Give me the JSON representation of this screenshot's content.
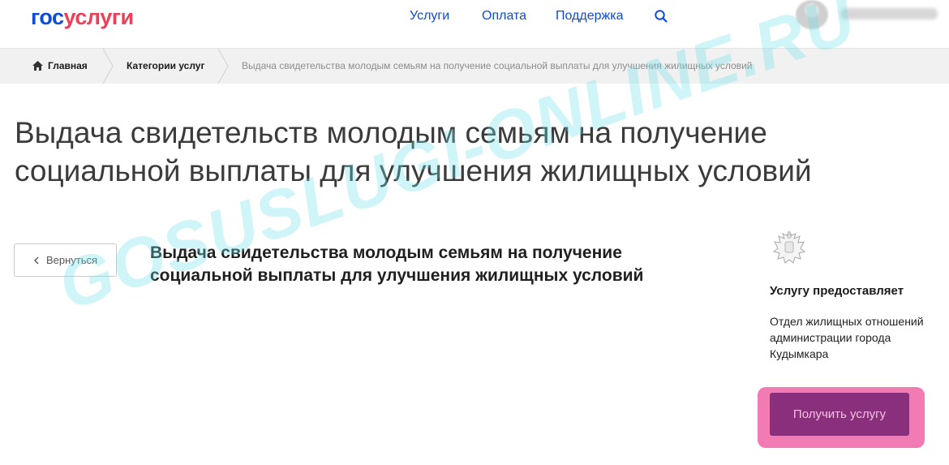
{
  "header": {
    "logo_gos": "гос",
    "logo_usl": "услуги",
    "nav": {
      "services": "Услуги",
      "payment": "Оплата",
      "support": "Поддержка"
    }
  },
  "breadcrumb": {
    "home": "Главная",
    "categories": "Категории услуг",
    "current": "Выдача свидетельства молодым семьям на получение социальной выплаты для улучшения жилищных условий"
  },
  "page": {
    "title": "Выдача свидетельств молодым семьям на получение социальной выплаты для улучшения жилищных условий",
    "back_label": "Вернуться",
    "subtitle": "Выдача свидетельства молодым семьям на получение социальной выплаты для улучшения жилищных условий"
  },
  "provider": {
    "heading": "Услугу предоставляет",
    "name": "Отдел жилищных отношений администрации города Кудымкара"
  },
  "actions": {
    "get_service_label": "Получить услугу"
  },
  "watermark": "GOSUSLUGI-ONLINE.RU",
  "colors": {
    "brand_blue": "#0d4cd3",
    "brand_red": "#ee3f58",
    "button_purple": "#8a2f7c",
    "highlight_pink": "#f27bb3"
  },
  "icons": [
    "search-icon",
    "home-icon",
    "chevron-left-icon",
    "coat-of-arms-icon",
    "breadcrumb-separator-icon"
  ]
}
